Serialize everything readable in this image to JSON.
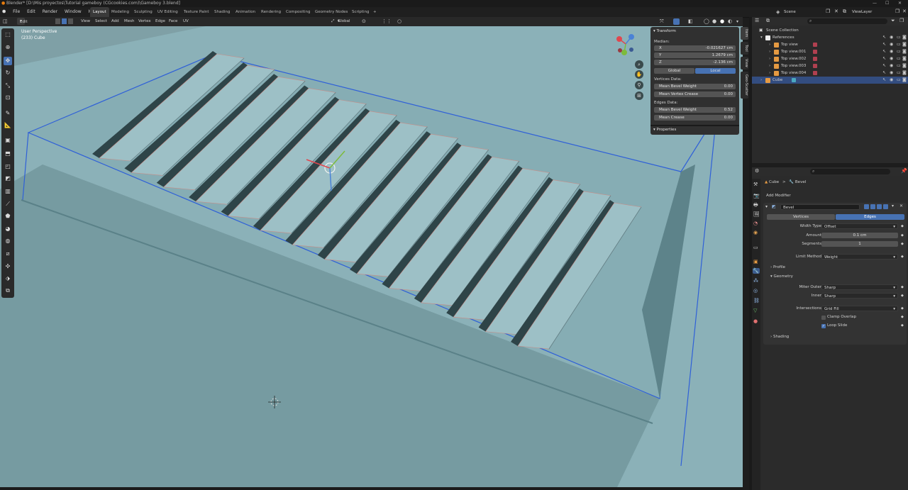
{
  "title_bar": {
    "text": "Blender* [D:\\Mis proyectos\\Tutorial gameboy (CGcookies.com)\\Gameboy 3.blend]"
  },
  "menu": {
    "items": [
      "File",
      "Edit",
      "Render",
      "Window",
      "Help"
    ]
  },
  "workspaces": [
    "Layout",
    "Modeling",
    "Sculpting",
    "UV Editing",
    "Texture Paint",
    "Shading",
    "Animation",
    "Rendering",
    "Compositing",
    "Geometry Nodes",
    "Scripting"
  ],
  "workspace_add": "+",
  "scene": {
    "label": "Scene"
  },
  "view_layer": {
    "label": "ViewLayer"
  },
  "viewport_header": {
    "mode": "Edit Mode",
    "menus": [
      "View",
      "Select",
      "Add",
      "Mesh",
      "Vertex",
      "Edge",
      "Face",
      "UV"
    ],
    "transform_orientation": "Global"
  },
  "viewport": {
    "perspective": "User Perspective",
    "object_label": "(233) Cube",
    "background": "#7fa0a6",
    "gizmo_axes": {
      "x": "#e0474f",
      "y": "#7dbb3b",
      "z": "#4a82d6"
    }
  },
  "n_panel": {
    "tabs": [
      "Item",
      "Tool",
      "View",
      "Geo-Scatter"
    ],
    "transform_header": "Transform",
    "median_label": "Median:",
    "coords": [
      {
        "axis": "X",
        "value": "-0.021627 cm"
      },
      {
        "axis": "Y",
        "value": "1.2679 cm"
      },
      {
        "axis": "Z",
        "value": "-2.136 cm"
      }
    ],
    "space_buttons": [
      "Global",
      "Local"
    ],
    "vertices_data_label": "Vertices Data:",
    "vertices_data": [
      {
        "label": "Mean Bevel Weight",
        "value": "0.00"
      },
      {
        "label": "Mean Vertex Crease",
        "value": "0.00"
      }
    ],
    "edges_data_label": "Edges Data:",
    "edges_data": [
      {
        "label": "Mean Bevel Weight",
        "value": "0.52"
      },
      {
        "label": "Mean Crease",
        "value": "0.00"
      }
    ],
    "properties_header": "Properties"
  },
  "outliner": {
    "root": "Scene Collection",
    "items": [
      {
        "label": "References",
        "level": 1
      },
      {
        "label": "Top view",
        "level": 2
      },
      {
        "label": "Top view.001",
        "level": 2
      },
      {
        "label": "Top view.002",
        "level": 2
      },
      {
        "label": "Top view.003",
        "level": 2
      },
      {
        "label": "Top view.004",
        "level": 2
      },
      {
        "label": "Cube",
        "level": 1
      }
    ]
  },
  "properties": {
    "breadcrumb_object": "Cube",
    "breadcrumb_sep": ">",
    "breadcrumb_modifier": "Bevel",
    "add_modifier": "Add Modifier",
    "modifier_name": "Bevel",
    "affect_tabs": [
      "Vertices",
      "Edges"
    ],
    "fields": [
      {
        "label": "Width Type",
        "value": "Offset"
      },
      {
        "label": "Amount",
        "value": "0.1 cm"
      },
      {
        "label": "Segments",
        "value": "1"
      },
      {
        "label": "Limit Method",
        "value": "Weight"
      }
    ],
    "profile_label": "Profile",
    "geometry_label": "Geometry",
    "geometry_fields": [
      {
        "label": "Miter Outer",
        "value": "Sharp"
      },
      {
        "label": "Inner",
        "value": "Sharp"
      },
      {
        "label": "Intersections",
        "value": "Grid Fill"
      }
    ],
    "clamp_overlap": "Clamp Overlap",
    "loop_slide": "Loop Slide",
    "shading_label": "Shading"
  }
}
